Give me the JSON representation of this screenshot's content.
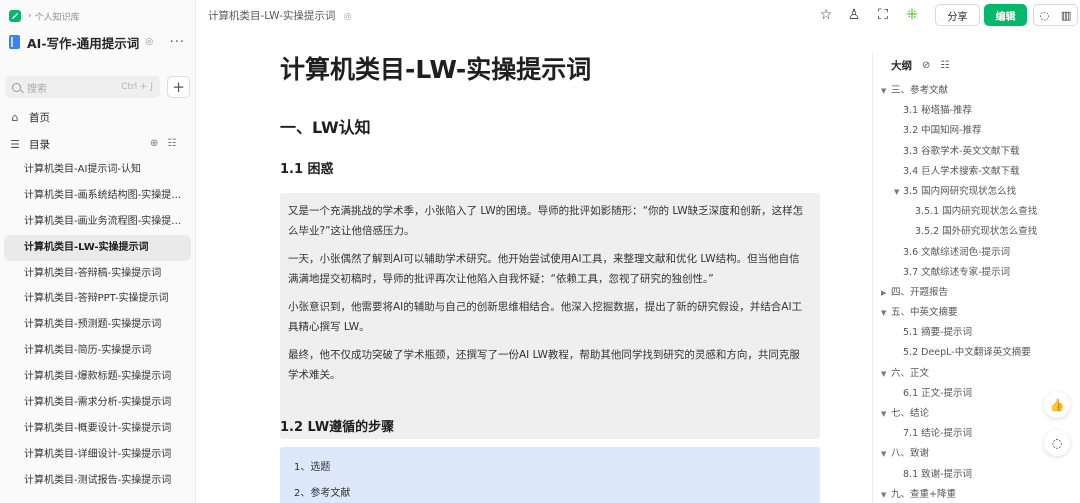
{
  "sidebar": {
    "breadcrumb": "个人知识库",
    "book_title": "AI-写作-通用提示词",
    "search_placeholder": "搜索",
    "search_shortcut": "Ctrl + J",
    "home_label": "首页",
    "toc_label": "目录",
    "docs": [
      {
        "label": "计算机类目-AI提示词-认知",
        "active": false
      },
      {
        "label": "计算机类目-画系统结构图-实操提示词",
        "active": false
      },
      {
        "label": "计算机类目-画业务流程图-实操提示词",
        "active": false
      },
      {
        "label": "计算机类目-LW-实操提示词",
        "active": true
      },
      {
        "label": "计算机类目-答辩稿-实操提示词",
        "active": false
      },
      {
        "label": "计算机类目-答辩PPT-实操提示词",
        "active": false
      },
      {
        "label": "计算机类目-预测题-实操提示词",
        "active": false
      },
      {
        "label": "计算机类目-简历-实操提示词",
        "active": false
      },
      {
        "label": "计算机类目-爆款标题-实操提示词",
        "active": false
      },
      {
        "label": "计算机类目-需求分析-实操提示词",
        "active": false
      },
      {
        "label": "计算机类目-概要设计-实操提示词",
        "active": false
      },
      {
        "label": "计算机类目-详细设计-实操提示词",
        "active": false
      },
      {
        "label": "计算机类目-测试报告-实操提示词",
        "active": false
      }
    ]
  },
  "header": {
    "doc_title": "计算机类目-LW-实操提示词",
    "share_label": "分享",
    "edit_label": "编辑"
  },
  "content": {
    "title": "计算机类目-LW-实操提示词",
    "section1": "一、LW认知",
    "section1_1": "1.1 困惑",
    "quote_paragraphs": [
      "又是一个充满挑战的学术季，小张陷入了 LW的困境。导师的批评如影随形：“你的 LW缺乏深度和创新，这样怎么毕业?”这让他倍感压力。",
      "一天，小张偶然了解到AI可以辅助学术研究。他开始尝试使用AI工具，来整理文献和优化 LW结构。但当他自信满满地提交初稿时，导师的批评再次让他陷入自我怀疑：“依赖工具，忽视了研究的独创性。”",
      "小张意识到，他需要将AI的辅助与自己的创新思维相结合。他深入挖掘数据，提出了新的研究假设，并结合AI工具精心撰写 LW。",
      "最终，他不仅成功突破了学术瓶颈，还撰写了一份AI LW教程，帮助其他同学找到研究的灵感和方向，共同克服学术难关。"
    ],
    "section1_2": "1.2 LW遵循的步骤",
    "steps": [
      "1、选题",
      "2、参考文献"
    ]
  },
  "outline": {
    "label": "大纲",
    "items": [
      {
        "label": "三、参考文献",
        "level": "l1",
        "arrow": "▼"
      },
      {
        "label": "3.1 秘塔猫-推荐",
        "level": "l2",
        "arrow": ""
      },
      {
        "label": "3.2 中国知网-推荐",
        "level": "l2",
        "arrow": ""
      },
      {
        "label": "3.3 谷歌学术-英文文献下载",
        "level": "l2",
        "arrow": ""
      },
      {
        "label": "3.4 巨人学术搜索-文献下载",
        "level": "l2",
        "arrow": ""
      },
      {
        "label": "3.5 国内网研究现状怎么找",
        "level": "l2a",
        "arrow": "▼"
      },
      {
        "label": "3.5.1 国内研究现状怎么查找",
        "level": "l3",
        "arrow": ""
      },
      {
        "label": "3.5.2 国外研究现状怎么查找",
        "level": "l3",
        "arrow": ""
      },
      {
        "label": "3.6 文献综述润色-提示词",
        "level": "l2",
        "arrow": ""
      },
      {
        "label": "3.7 文献综述专家-提示词",
        "level": "l2",
        "arrow": ""
      },
      {
        "label": "四、开题报告",
        "level": "l1",
        "arrow": "▶"
      },
      {
        "label": "五、中英文摘要",
        "level": "l1",
        "arrow": "▼"
      },
      {
        "label": "5.1 摘要-提示词",
        "level": "l2",
        "arrow": ""
      },
      {
        "label": "5.2 DeepL-中文翻译英文摘要",
        "level": "l2",
        "arrow": ""
      },
      {
        "label": "六、正文",
        "level": "l1",
        "arrow": "▼"
      },
      {
        "label": "6.1 正文-提示词",
        "level": "l2",
        "arrow": ""
      },
      {
        "label": "七、结论",
        "level": "l1",
        "arrow": "▼"
      },
      {
        "label": "7.1 结论-提示词",
        "level": "l2",
        "arrow": ""
      },
      {
        "label": "八、致谢",
        "level": "l1",
        "arrow": "▼"
      },
      {
        "label": "8.1 致谢-提示词",
        "level": "l2",
        "arrow": ""
      },
      {
        "label": "九、查重+降重",
        "level": "l1",
        "arrow": "▼"
      }
    ]
  },
  "colors": {
    "accent": "#00b96b",
    "steps_bg": "#dde9fb",
    "quote_bg": "#efefef"
  }
}
